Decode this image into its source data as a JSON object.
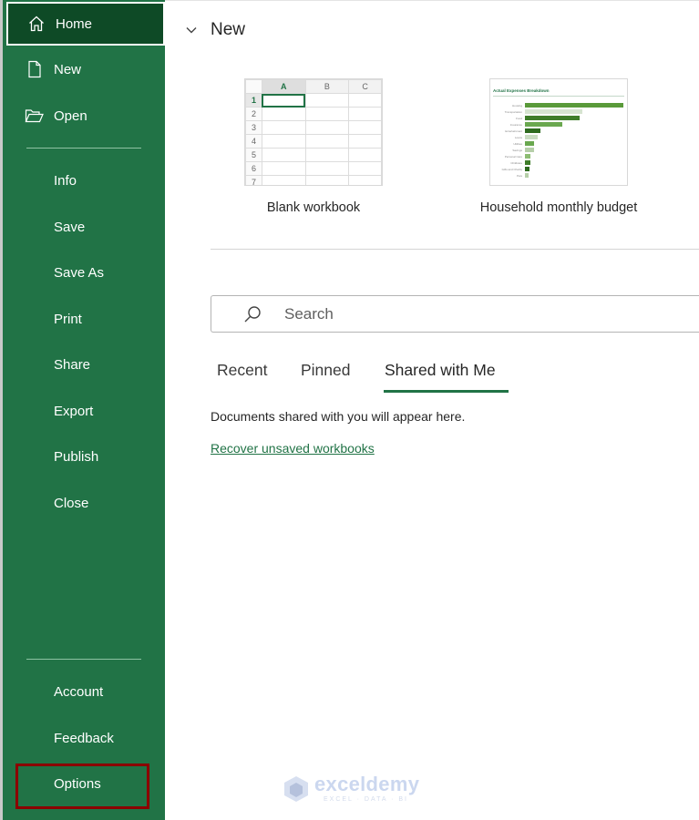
{
  "sidebar": {
    "items_top": [
      {
        "label": "Home",
        "icon": "home-icon",
        "active": true
      },
      {
        "label": "New",
        "icon": "new-document-icon"
      },
      {
        "label": "Open",
        "icon": "open-folder-icon"
      }
    ],
    "items_mid": [
      {
        "label": "Info"
      },
      {
        "label": "Save"
      },
      {
        "label": "Save As"
      },
      {
        "label": "Print"
      },
      {
        "label": "Share"
      },
      {
        "label": "Export"
      },
      {
        "label": "Publish"
      },
      {
        "label": "Close"
      }
    ],
    "items_bottom": [
      {
        "label": "Account"
      },
      {
        "label": "Feedback"
      },
      {
        "label": "Options",
        "highlighted": true
      }
    ],
    "colors": {
      "background": "#217346",
      "active": "#0e4a26",
      "highlight_box": "#8b0000"
    }
  },
  "main": {
    "section_title": "New",
    "templates": [
      {
        "caption": "Blank workbook",
        "thumb": {
          "columns": [
            "A",
            "B",
            "C"
          ],
          "rows": [
            "1",
            "2",
            "3",
            "4",
            "5",
            "6",
            "7"
          ]
        }
      },
      {
        "caption": "Household monthly budget",
        "thumb": {
          "title": "Actual Expenses Breakdown",
          "bars": [
            {
              "label": "Housing",
              "value": 1.0,
              "color": "#5a9a3a"
            },
            {
              "label": "Transportation",
              "value": 0.58,
              "color": "#d6e4d0"
            },
            {
              "label": "Food",
              "value": 0.56,
              "color": "#3f7d2a"
            },
            {
              "label": "Insurance",
              "value": 0.38,
              "color": "#6aa84f"
            },
            {
              "label": "Entertainment",
              "value": 0.16,
              "color": "#2e6b1f"
            },
            {
              "label": "Loans",
              "value": 0.13,
              "color": "#c9dcc1"
            },
            {
              "label": "Utilities",
              "value": 0.09,
              "color": "#6aa84f"
            },
            {
              "label": "Savings",
              "value": 0.09,
              "color": "#b6cfa9"
            },
            {
              "label": "Personal Care",
              "value": 0.06,
              "color": "#8dbd73"
            },
            {
              "label": "Childcare",
              "value": 0.06,
              "color": "#3f7d2a"
            },
            {
              "label": "Gifts and Charity",
              "value": 0.05,
              "color": "#2e6b1f"
            },
            {
              "label": "Pets",
              "value": 0.04,
              "color": "#b6cfa9"
            }
          ]
        }
      }
    ],
    "search": {
      "placeholder": "Search"
    },
    "tabs": [
      {
        "label": "Recent"
      },
      {
        "label": "Pinned"
      },
      {
        "label": "Shared with Me",
        "active": true
      }
    ],
    "empty_message": "Documents shared with you will appear here.",
    "recover_link": "Recover unsaved workbooks"
  },
  "watermark": {
    "name": "exceldemy",
    "tagline": "EXCEL · DATA · BI"
  }
}
